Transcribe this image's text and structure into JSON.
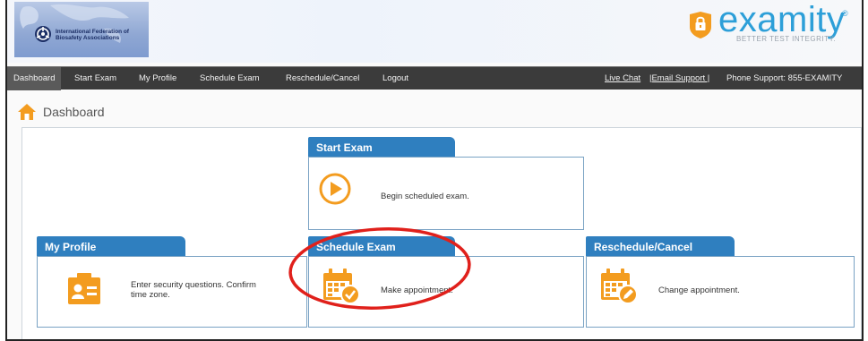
{
  "header": {
    "org_logo_text": "International Federation of Biosafety Associations",
    "brand_name": "examity",
    "brand_mark": "®",
    "brand_tagline": "BETTER TEST INTEGRITY."
  },
  "nav": {
    "items": [
      {
        "label": "Dashboard"
      },
      {
        "label": "Start Exam"
      },
      {
        "label": "My Profile"
      },
      {
        "label": "Schedule Exam"
      },
      {
        "label": "Reschedule/Cancel"
      },
      {
        "label": "Logout"
      }
    ],
    "live_chat": "Live Chat",
    "email_support": "|Email Support |",
    "phone_support": "Phone Support: 855-EXAMITY"
  },
  "page": {
    "title": "Dashboard"
  },
  "cards": {
    "start_exam": {
      "title": "Start Exam",
      "text": "Begin scheduled exam."
    },
    "my_profile": {
      "title": "My Profile",
      "text": "Enter security questions. Confirm time zone."
    },
    "schedule_exam": {
      "title": "Schedule Exam",
      "text": "Make appointment."
    },
    "reschedule": {
      "title": "Reschedule/Cancel",
      "text": "Change appointment."
    }
  },
  "colors": {
    "tab_blue": "#2f7fbf",
    "icon_orange": "#f39c1f",
    "nav_bg": "#3b3b3b",
    "annotation_red": "#e0201b",
    "brand_blue": "#2d9fd8"
  }
}
